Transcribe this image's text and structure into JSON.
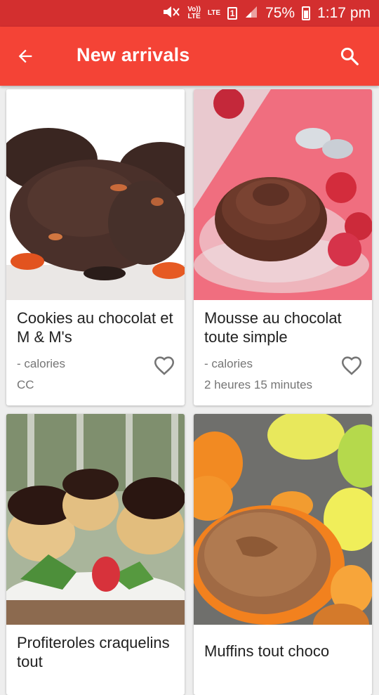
{
  "status_bar": {
    "volte": "Vo))",
    "lte_small": "LTE",
    "lte": "LTE",
    "sim": "1",
    "battery": "75%",
    "time": "1:17 pm"
  },
  "app_bar": {
    "title": "New arrivals",
    "back_icon": "arrow-back-icon",
    "search_icon": "search-icon"
  },
  "colors": {
    "status_bar": "#d32f2f",
    "app_bar": "#f44336"
  },
  "recipes": [
    {
      "title": "Cookies au chocolat et M & M's",
      "calories": "- calories",
      "meta": "CC",
      "image": "chocolate-cookies-photo"
    },
    {
      "title": "Mousse au chocolat toute simple",
      "calories": "- calories",
      "meta": "2 heures 15 minutes",
      "image": "chocolate-mousse-photo"
    },
    {
      "title": "Profiteroles craquelins tout",
      "calories": "",
      "meta": "",
      "image": "profiteroles-photo"
    },
    {
      "title": "Muffins tout choco",
      "calories": "",
      "meta": "",
      "image": "chocolate-muffins-photo"
    }
  ]
}
